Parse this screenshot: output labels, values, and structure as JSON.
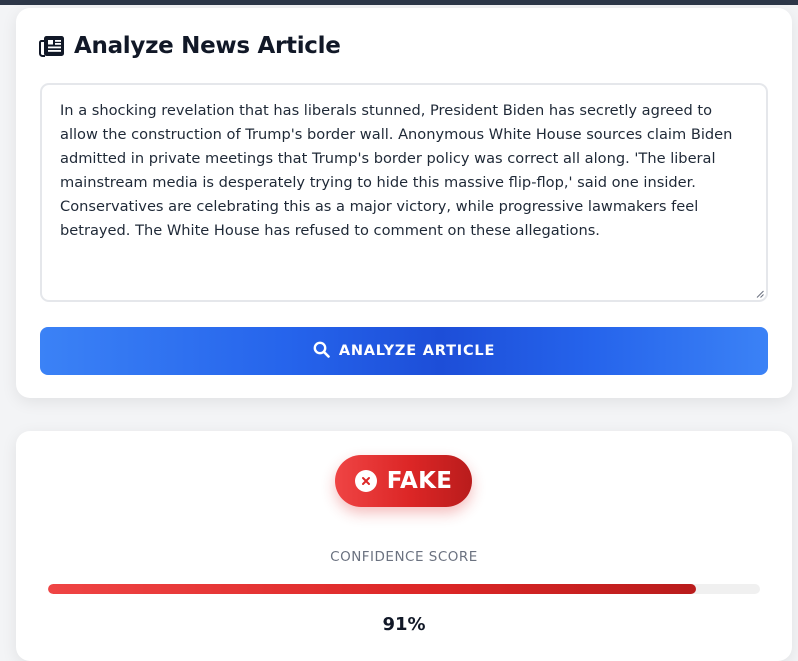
{
  "analyze": {
    "title": "Analyze News Article",
    "title_icon": "newspaper-icon",
    "article_text": "In a shocking revelation that has liberals stunned, President Biden has secretly agreed to allow the construction of Trump's border wall. Anonymous White House sources claim Biden admitted in private meetings that Trump's border policy was correct all along. 'The liberal mainstream media is desperately trying to hide this massive flip-flop,' said one insider. Conservatives are celebrating this as a major victory, while progressive lawmakers feel betrayed. The White House has refused to comment on these allegations.",
    "button_label": "ANALYZE ARTICLE",
    "button_icon": "search-icon"
  },
  "result": {
    "verdict": "FAKE",
    "verdict_icon": "x-circle-icon",
    "confidence_label": "CONFIDENCE SCORE",
    "confidence_percent": 91,
    "confidence_text": "91%"
  },
  "colors": {
    "accent_blue": "#2563eb",
    "fake_red": "#dc2626",
    "topbar": "#2d3748"
  }
}
